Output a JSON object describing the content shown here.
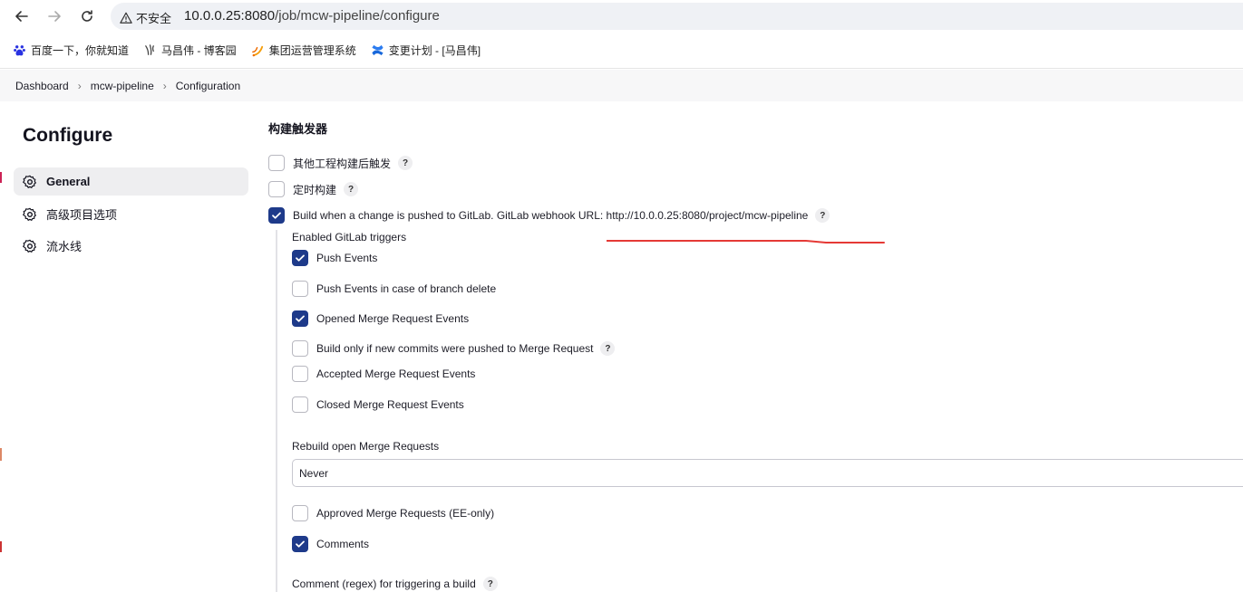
{
  "browser": {
    "insecure_label": "不安全",
    "url_host": "10.0.0.25:8080",
    "url_path": "/job/mcw-pipeline/configure",
    "bookmarks": [
      {
        "label": "百度一下，你就知道",
        "icon": "baidu-paw-icon"
      },
      {
        "label": "马昌伟 - 博客园",
        "icon": "cnblogs-icon"
      },
      {
        "label": "集团运营管理系统",
        "icon": "flame-icon"
      },
      {
        "label": "变更计划 - [马昌伟]",
        "icon": "confluence-icon"
      }
    ]
  },
  "breadcrumb": {
    "items": [
      "Dashboard",
      "mcw-pipeline",
      "Configuration"
    ]
  },
  "sidebar": {
    "title": "Configure",
    "items": [
      {
        "label": "General",
        "active": true,
        "icon": "gear-icon"
      },
      {
        "label": "高级项目选项",
        "active": false,
        "icon": "gear-icon"
      },
      {
        "label": "流水线",
        "active": false,
        "icon": "gear-icon"
      }
    ]
  },
  "main": {
    "section_title": "构建触发器",
    "triggers": [
      {
        "label": "其他工程构建后触发",
        "checked": false,
        "help": true
      },
      {
        "label": "定时构建",
        "checked": false,
        "help": true
      },
      {
        "label": "Build when a change is pushed to GitLab. GitLab webhook URL: http://10.0.0.25:8080/project/mcw-pipeline",
        "checked": true,
        "help": true
      }
    ],
    "gitlab_triggers_label": "Enabled GitLab triggers",
    "gitlab_triggers": [
      {
        "label": "Push Events",
        "checked": true,
        "help": false
      },
      {
        "label": "Push Events in case of branch delete",
        "checked": false,
        "help": false
      },
      {
        "label": "Opened Merge Request Events",
        "checked": true,
        "help": false
      },
      {
        "label": "Build only if new commits were pushed to Merge Request",
        "checked": false,
        "help": true
      },
      {
        "label": "Accepted Merge Request Events",
        "checked": false,
        "help": false
      },
      {
        "label": "Closed Merge Request Events",
        "checked": false,
        "help": false
      }
    ],
    "rebuild_label": "Rebuild open Merge Requests",
    "rebuild_value": "Never",
    "more_options": [
      {
        "label": "Approved Merge Requests (EE-only)",
        "checked": false
      },
      {
        "label": "Comments",
        "checked": true
      }
    ],
    "comment_regex_label": "Comment (regex) for triggering a build",
    "help_symbol": "?"
  },
  "colors": {
    "checkbox_checked": "#1e3a8a",
    "annotation_red": "#e53935"
  }
}
